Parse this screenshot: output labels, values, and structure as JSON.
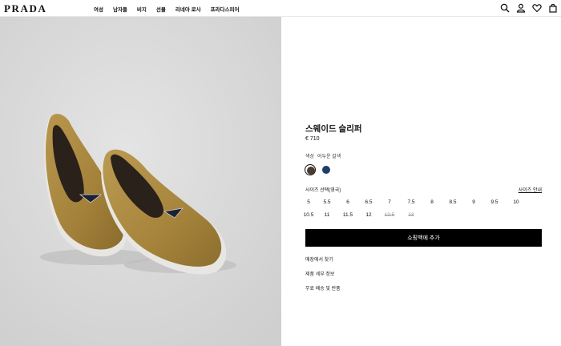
{
  "brand": {
    "logo": "PRADA"
  },
  "nav": {
    "items": [
      "여성",
      "남자들",
      "비지",
      "선물",
      "리네아 로사",
      "프라다스피어"
    ]
  },
  "header_icons": [
    "search-icon",
    "user-icon",
    "heart-icon",
    "bag-icon"
  ],
  "product": {
    "title": "스웨이드 슬리퍼",
    "price": "€ 710",
    "color_label": "색상",
    "color_value": "어두운 갈색",
    "colors": [
      {
        "name": "dark-brown",
        "hex": "#4a3b33",
        "selected": true
      },
      {
        "name": "navy",
        "hex": "#1f3e6e",
        "selected": false
      }
    ],
    "size_label": "사이즈 선택(영국)",
    "size_guide": "사이즈 안내",
    "sizes_row1": [
      "5",
      "5.5",
      "6",
      "6.5",
      "7",
      "7.5",
      "8",
      "8.5",
      "9",
      "9.5",
      "10"
    ],
    "sizes_row2": [
      "10.5",
      "11",
      "11.5",
      "12",
      "12.5",
      "13"
    ],
    "sold_out": [
      "12.5",
      "13"
    ],
    "add_to_bag": "쇼핑백에 추가",
    "links": [
      "매장에서 찾기",
      "제품 세부 정보",
      "무료 배송 및 반품"
    ]
  },
  "colors": {
    "image_bg": "#dcdcdc",
    "suede": "#a9863f",
    "button": "#000000"
  }
}
